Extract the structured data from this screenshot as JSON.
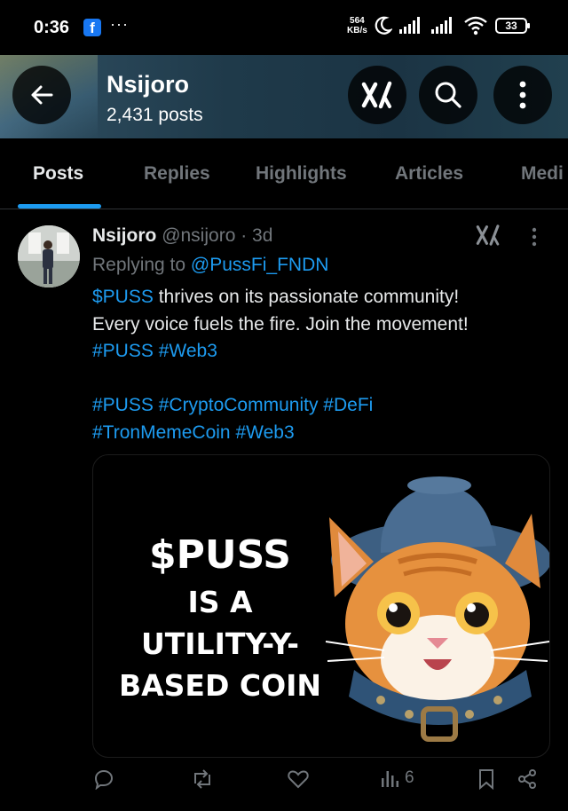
{
  "status_bar": {
    "time": "0:36",
    "app_icon": "facebook-icon",
    "more": "···",
    "speed_value": "564",
    "speed_unit": "KB/s",
    "battery": "33"
  },
  "header": {
    "name": "Nsijoro",
    "post_count": "2,431 posts",
    "buttons": [
      "back-arrow-icon",
      "grok-icon",
      "search-icon",
      "more-vertical-icon"
    ]
  },
  "tabs": [
    {
      "label": "Posts",
      "active": true
    },
    {
      "label": "Replies",
      "active": false
    },
    {
      "label": "Highlights",
      "active": false
    },
    {
      "label": "Articles",
      "active": false
    },
    {
      "label": "Medi",
      "active": false
    }
  ],
  "post": {
    "display_name": "Nsijoro",
    "handle": "@nsijoro",
    "time": "· 3d",
    "replying_prefix": "Replying to",
    "replying_to": "@PussFi_FNDN",
    "text": {
      "l1_tag": "$PUSS",
      "l1_rest": " thrives on its passionate community!",
      "l2": "Every voice fuels the fire. Join the movement!",
      "l3_tag1": "#PUSS",
      "l3_tag2": "#Web3",
      "l5_tag1": "#PUSS",
      "l5_tag2": "#CryptoCommunity",
      "l5_tag3": "#DeFi",
      "l6_tag1": "#TronMemeCoin",
      "l6_tag2": "#Web3"
    },
    "media": {
      "line1": "$PUSS",
      "line2": "IS A",
      "line3": "UTILITY-Y-",
      "line4": "BASED COIN"
    },
    "actions": {
      "reply_icon": "reply-icon",
      "repost_icon": "repost-icon",
      "like_icon": "heart-icon",
      "views_icon": "views-icon",
      "views": "6",
      "bookmark_icon": "bookmark-icon",
      "share_icon": "share-icon"
    }
  },
  "colors": {
    "accent": "#1d9bf0",
    "muted": "#71767b",
    "text": "#e7e9ea",
    "background": "#000000"
  }
}
